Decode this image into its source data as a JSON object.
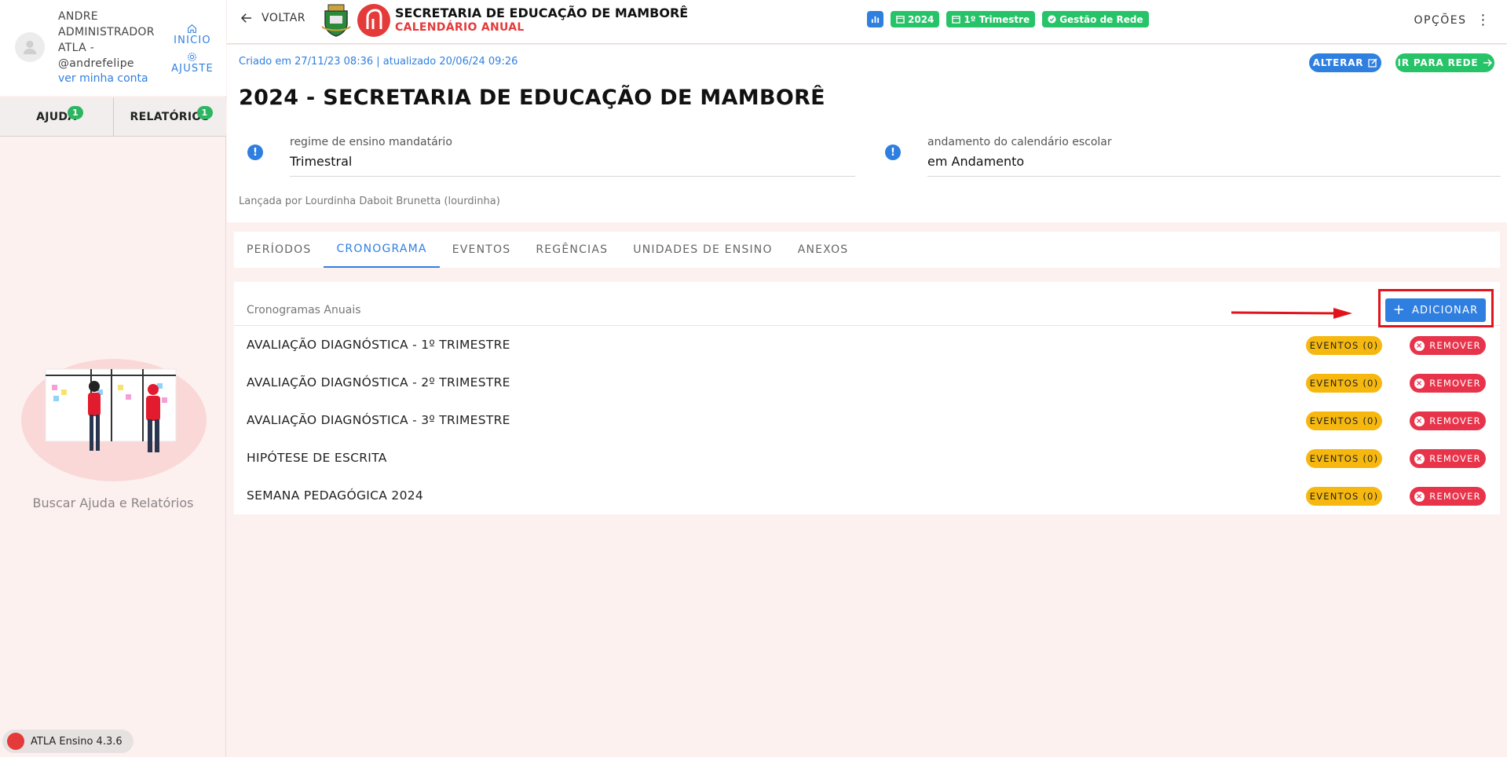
{
  "user": {
    "name_line1": "ANDRE",
    "name_line2": "ADMINISTRADOR",
    "name_line3": "ATLA -",
    "handle": "@andrefelipe",
    "account_link": "ver minha conta"
  },
  "side_nav": {
    "home": "INICIO",
    "settings": "AJUSTE"
  },
  "help_tabs": [
    {
      "label": "AJUDA",
      "count": "1"
    },
    {
      "label": "RELATÓRIOS",
      "count": "1"
    }
  ],
  "help_caption": "Buscar Ajuda e Relatórios",
  "version": "ATLA Ensino 4.3.6",
  "topbar": {
    "back_label": "VOLTAR",
    "title": "SECRETARIA DE EDUCAÇÃO DE MAMBORÊ",
    "subtitle": "CALENDÁRIO ANUAL",
    "chips": [
      "2024",
      "1º Trimestre",
      "Gestão de Rede"
    ],
    "options_label": "OPÇÕES"
  },
  "header": {
    "meta": "Criado em 27/11/23 08:36 | atualizado 20/06/24 09:26",
    "alter_label": "ALTERAR",
    "network_label": "IR PARA REDE",
    "title": "2024 - SECRETARIA DE EDUCAÇÃO DE MAMBORÊ",
    "field1_label": "regime de ensino mandatário",
    "field1_value": "Trimestral",
    "field2_label": "andamento do calendário escolar",
    "field2_value": "em Andamento",
    "released_by": "Lançada por Lourdinha Daboit Brunetta (lourdinha)"
  },
  "tabs": [
    "PERÍODOS",
    "CRONOGRAMA",
    "EVENTOS",
    "REGÊNCIAS",
    "UNIDADES DE ENSINO",
    "ANEXOS"
  ],
  "list": {
    "caption": "Cronogramas Anuais",
    "add_label": "ADICIONAR",
    "events_label": "EVENTOS (0)",
    "remove_label": "REMOVER",
    "rows": [
      "AVALIAÇÃO DIAGNÓSTICA - 1º TRIMESTRE",
      "AVALIAÇÃO DIAGNÓSTICA - 2º TRIMESTRE",
      "AVALIAÇÃO DIAGNÓSTICA - 3º TRIMESTRE",
      "HIPÓTESE DE ESCRITA",
      "SEMANA PEDAGÓGICA 2024"
    ]
  },
  "colors": {
    "primary": "#2f7fe0",
    "success": "#27c368",
    "danger": "#e8344b",
    "warning": "#f6b80f",
    "brand": "#e53a3a"
  }
}
